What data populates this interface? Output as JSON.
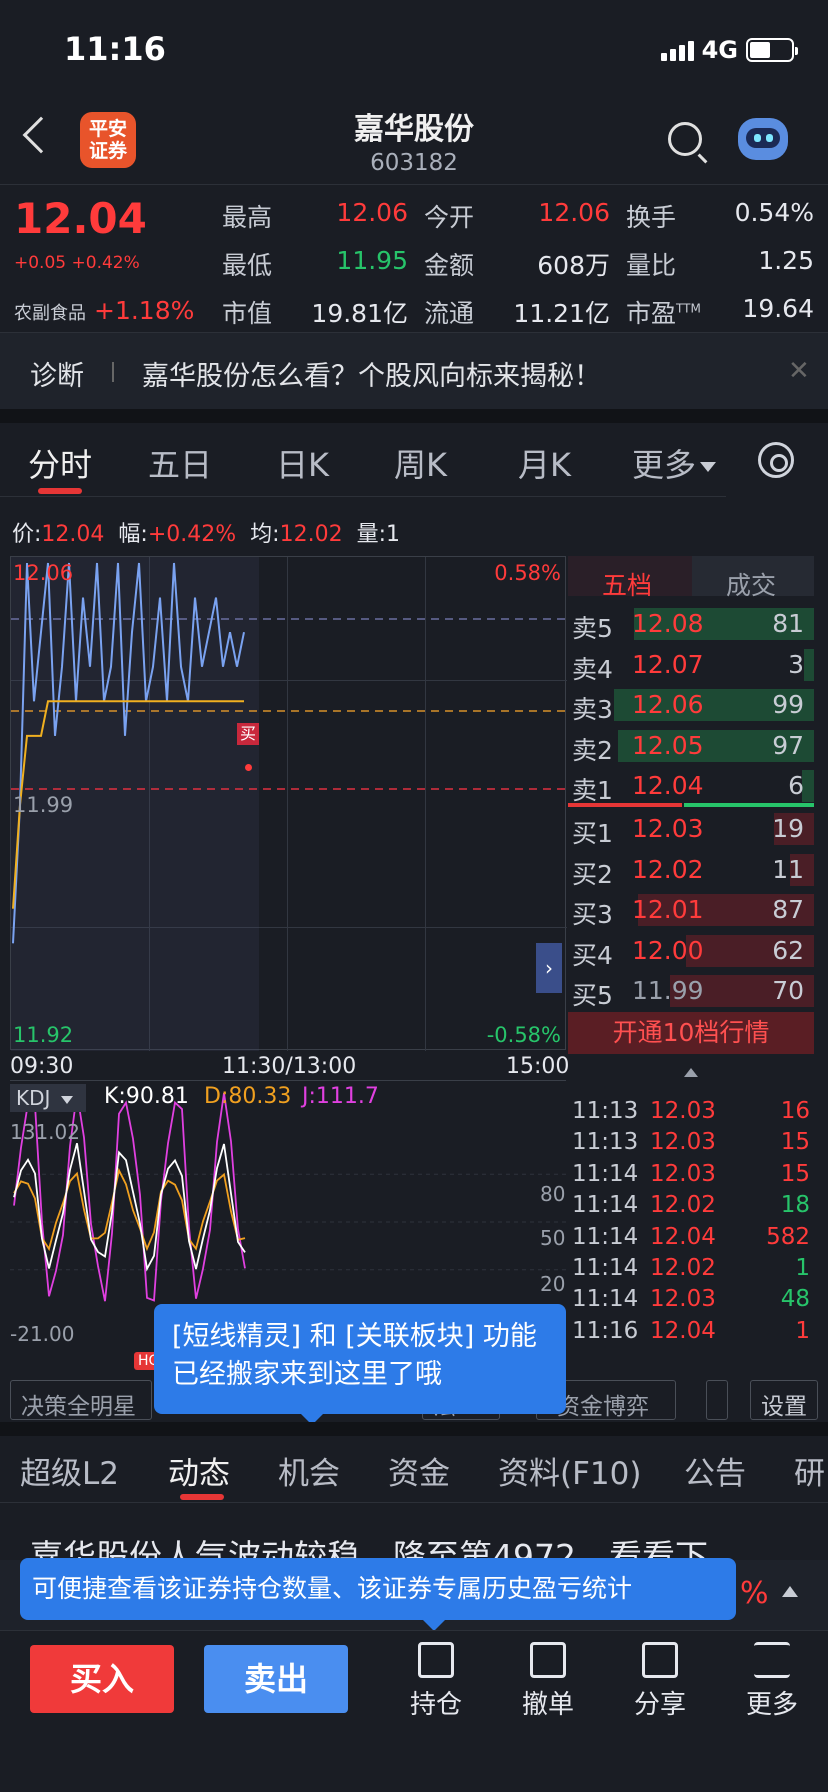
{
  "status": {
    "time": "11:16",
    "network": "4G"
  },
  "header": {
    "title": "嘉华股份",
    "code": "603182",
    "logo_line1": "平安",
    "logo_line2": "证券"
  },
  "quote": {
    "price": "12.04",
    "change": "+0.05",
    "change_pct": "+0.42%",
    "sector": "农副食品",
    "sector_pct": "+1.18%",
    "items": [
      {
        "label": "最高",
        "value": "12.06",
        "color": "#ff3b3b"
      },
      {
        "label": "今开",
        "value": "12.06",
        "color": "#ff3b3b"
      },
      {
        "label": "换手",
        "value": "0.54%",
        "color": "#e6e8ee"
      },
      {
        "label": "最低",
        "value": "11.95",
        "color": "#27c46a"
      },
      {
        "label": "金额",
        "value": "608万",
        "color": "#e6e8ee"
      },
      {
        "label": "量比",
        "value": "1.25",
        "color": "#e6e8ee"
      },
      {
        "label": "市值",
        "value": "19.81亿",
        "color": "#e6e8ee"
      },
      {
        "label": "流通",
        "value": "11.21亿",
        "color": "#e6e8ee"
      },
      {
        "label": "市盈",
        "value": "19.64",
        "color": "#e6e8ee",
        "sup": "TTM"
      }
    ]
  },
  "diagnosis": {
    "label": "诊断",
    "message": "嘉华股份怎么看？个股风向标来揭秘！"
  },
  "chart_tabs": [
    "分时",
    "五日",
    "日K",
    "周K",
    "月K",
    "更多"
  ],
  "infoline": {
    "price_label": "价:",
    "price": "12.04",
    "amp_label": "幅:",
    "amp": "+0.42%",
    "avg_label": "均:",
    "avg": "12.02",
    "vol_label": "量:",
    "vol": "1"
  },
  "chart_labels": {
    "top_price": "12.06",
    "mid_price": "11.99",
    "bottom_price": "11.92",
    "top_pct": "0.58%",
    "bottom_pct": "-0.58%",
    "buy_marker": "买",
    "t_start": "09:30",
    "t_mid": "11:30/13:00",
    "t_end": "15:00"
  },
  "chart_data": {
    "type": "line",
    "title": "",
    "ylim": [
      11.92,
      12.06
    ],
    "x": [
      "09:30",
      "11:30/13:00",
      "15:00"
    ],
    "series": [
      {
        "values": [
          11.95,
          11.99,
          12.06,
          12.02,
          12.04,
          12.06,
          12.01,
          12.03,
          12.06,
          12.02,
          12.05,
          12.03,
          12.06,
          12.02,
          12.03,
          12.06,
          12.01,
          12.04,
          12.06,
          12.02,
          12.03,
          12.05,
          12.02,
          12.06,
          12.03,
          12.02,
          12.05,
          12.03,
          12.04,
          12.05,
          12.03,
          12.04,
          12.03,
          12.04
        ]
      },
      {
        "values": [
          11.96,
          11.99,
          12.01,
          12.01,
          12.01,
          12.02,
          12.02,
          12.02,
          12.02,
          12.02,
          12.02,
          12.02,
          12.02,
          12.02,
          12.02,
          12.02,
          12.02,
          12.02,
          12.02,
          12.02,
          12.02,
          12.02,
          12.02,
          12.02,
          12.02,
          12.02,
          12.02,
          12.02,
          12.02,
          12.02,
          12.02,
          12.02,
          12.02,
          12.02
        ]
      }
    ]
  },
  "kdj": {
    "name": "KDJ",
    "k": "K:90.81",
    "d": "D:80.33",
    "j": "J:111.7",
    "max": "131.02",
    "min": "-21.00",
    "levels": [
      "80",
      "50",
      "20"
    ],
    "k_color": "#ffffff",
    "d_color": "#f0a020",
    "j_color": "#e040e0"
  },
  "orderbook": {
    "tabs": [
      "五档",
      "成交"
    ],
    "asks": [
      {
        "label": "卖5",
        "price": "12.08",
        "vol": "81",
        "bar": 0.9
      },
      {
        "label": "卖4",
        "price": "12.07",
        "vol": "3",
        "bar": 0.05
      },
      {
        "label": "卖3",
        "price": "12.06",
        "vol": "99",
        "bar": 1.0
      },
      {
        "label": "卖2",
        "price": "12.05",
        "vol": "97",
        "bar": 0.98
      },
      {
        "label": "卖1",
        "price": "12.04",
        "vol": "6",
        "bar": 0.06
      }
    ],
    "bids": [
      {
        "label": "买1",
        "price": "12.03",
        "vol": "19",
        "bar": 0.2
      },
      {
        "label": "买2",
        "price": "12.02",
        "vol": "11",
        "bar": 0.12
      },
      {
        "label": "买3",
        "price": "12.01",
        "vol": "87",
        "bar": 0.88
      },
      {
        "label": "买4",
        "price": "12.00",
        "vol": "62",
        "bar": 0.64
      },
      {
        "label": "买5",
        "price": "11.99",
        "vol": "70",
        "bar": 0.72
      }
    ],
    "open_btn": "开通10档行情",
    "trades": [
      {
        "time": "11:13",
        "price": "12.03",
        "vol": "16",
        "vcolor": "#ff3b3b"
      },
      {
        "time": "11:13",
        "price": "12.03",
        "vol": "15",
        "vcolor": "#ff3b3b"
      },
      {
        "time": "11:14",
        "price": "12.03",
        "vol": "15",
        "vcolor": "#ff3b3b"
      },
      {
        "time": "11:14",
        "price": "12.02",
        "vol": "18",
        "vcolor": "#27c46a"
      },
      {
        "time": "11:14",
        "price": "12.04",
        "vol": "582",
        "vcolor": "#ff3b3b"
      },
      {
        "time": "11:14",
        "price": "12.02",
        "vol": "1",
        "vcolor": "#27c46a"
      },
      {
        "time": "11:14",
        "price": "12.03",
        "vol": "48",
        "vcolor": "#27c46a"
      },
      {
        "time": "11:16",
        "price": "12.04",
        "vol": "1",
        "vcolor": "#ff3b3b"
      }
    ]
  },
  "toolbar": {
    "btn1": "决策全明星",
    "hot": "HOT",
    "btn2": "资金博弈",
    "settings": "设置",
    "partial": "法"
  },
  "tooltip1": {
    "line1": "[短线精灵] 和 [关联板块] 功能",
    "line2": "已经搬家来到这里了哦"
  },
  "sub_tabs": [
    "超级L2",
    "动态",
    "机会",
    "资金",
    "资料(F10)",
    "公告",
    "研"
  ],
  "news": {
    "headline": "嘉华股份人气波动较稳，降至第4972，看看下",
    "pct": "%"
  },
  "tooltip2": {
    "text": "可便捷查看该证券持仓数量、该证券专属历史盈亏统计"
  },
  "bottom": {
    "buy": "买入",
    "sell": "卖出",
    "hold": "持仓",
    "cancel": "撤单",
    "share": "分享",
    "more": "更多"
  }
}
